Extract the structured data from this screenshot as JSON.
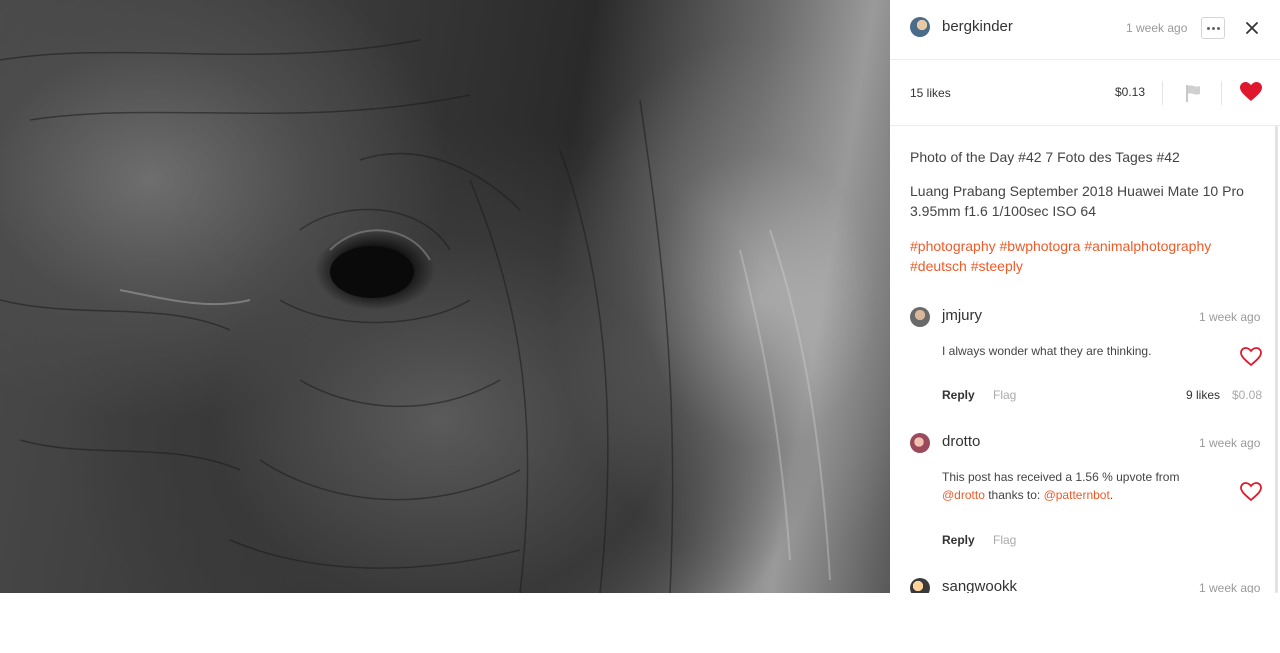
{
  "post": {
    "author": "bergkinder",
    "time": "1 week ago",
    "likes": "15 likes",
    "payout": "$0.13",
    "title": "Photo of the Day #42 7 Foto des Tages #42",
    "details": "Luang Prabang September 2018 Huawei Mate 10 Pro 3.95mm f1.6 1/100sec ISO 64",
    "tags_line1": "#photography #bwphotogra #animalphotography",
    "tags_line2": "#deutsch #steeply"
  },
  "comments": [
    {
      "author": "jmjury",
      "time": "1 week ago",
      "text": "I always wonder what they are thinking.",
      "reply": "Reply",
      "flag": "Flag",
      "likes": "9 likes",
      "payout": "$0.08"
    },
    {
      "author": "drotto",
      "time": "1 week ago",
      "text_before": "This post has received a 1.56 % upvote from",
      "link1": "@drotto",
      "text_middle": " thanks to: ",
      "link2": "@patternbot",
      "text_after": ".",
      "reply": "Reply",
      "flag": "Flag"
    },
    {
      "author": "sangwookk",
      "time": "1 week ago"
    }
  ],
  "icons": {
    "more": "more-options-icon",
    "close": "close-icon",
    "flag": "flag-icon",
    "heart": "heart-icon"
  },
  "colors": {
    "accent": "#f05a28",
    "heart": "#e0182d"
  }
}
